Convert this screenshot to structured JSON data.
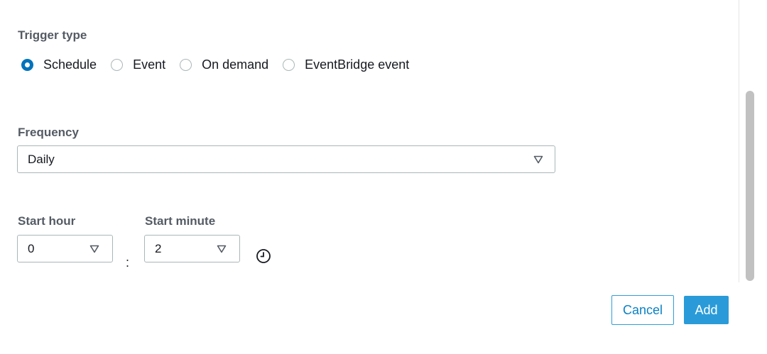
{
  "trigger": {
    "label": "Trigger type",
    "options": [
      {
        "label": "Schedule",
        "checked": true
      },
      {
        "label": "Event",
        "checked": false
      },
      {
        "label": "On demand",
        "checked": false
      },
      {
        "label": "EventBridge event",
        "checked": false
      }
    ]
  },
  "frequency": {
    "label": "Frequency",
    "value": "Daily"
  },
  "start_hour": {
    "label": "Start hour",
    "value": "0"
  },
  "start_minute": {
    "label": "Start minute",
    "value": "2"
  },
  "separator": ":",
  "icons": {
    "caret": "caret-down-icon",
    "clock": "clock-icon"
  },
  "buttons": {
    "cancel": "Cancel",
    "add": "Add"
  },
  "colors": {
    "accent": "#0073bb",
    "primary_button": "#2a9bd8",
    "label": "#545b64",
    "border": "#aab7b8"
  }
}
